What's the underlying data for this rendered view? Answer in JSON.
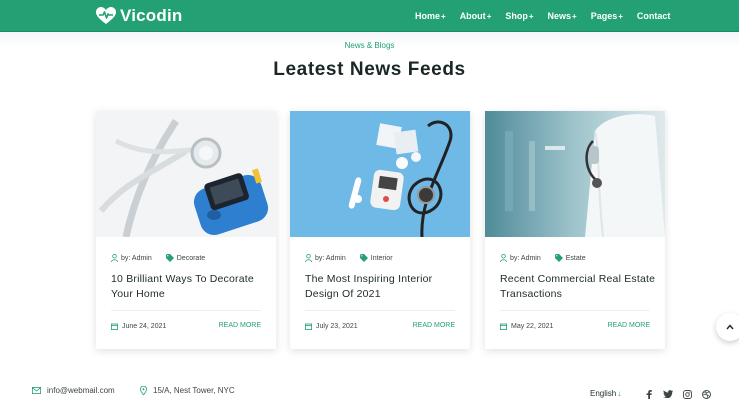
{
  "brand": {
    "name": "Vicodin",
    "logo_icon": "heart-pulse-icon"
  },
  "nav": {
    "items": [
      {
        "label": "Home",
        "suffix": "+"
      },
      {
        "label": "About",
        "suffix": "+"
      },
      {
        "label": "Shop",
        "suffix": "+"
      },
      {
        "label": "News",
        "suffix": "+"
      },
      {
        "label": "Pages",
        "suffix": "+"
      },
      {
        "label": "Contact",
        "suffix": ""
      }
    ]
  },
  "section": {
    "eyebrow": "News & Blogs",
    "title": "Leatest News Feeds"
  },
  "cards": [
    {
      "author": "by: Admin",
      "category": "Decorate",
      "title": "10 Brilliant Ways To Decorate Your Home",
      "date": "June 24, 2021",
      "cta": "READ MORE",
      "image": "glucose-meter-stethoscope"
    },
    {
      "author": "by: Admin",
      "category": "Interior",
      "title": "The Most Inspiring Interior Design Of 2021",
      "date": "July 23, 2021",
      "cta": "READ MORE",
      "image": "stethoscope-medical-supplies"
    },
    {
      "author": "by: Admin",
      "category": "Estate",
      "title": "Recent Commercial Real Estate Transactions",
      "date": "May 22, 2021",
      "cta": "READ MORE",
      "image": "doctor-hospital-corridor"
    }
  ],
  "footer": {
    "email": "info@webmail.com",
    "address": "15/A, Nest Tower, NYC",
    "language": "English",
    "social": [
      "facebook-icon",
      "twitter-icon",
      "instagram-icon",
      "dribbble-icon"
    ]
  },
  "colors": {
    "accent": "#23a074",
    "text": "#1f2a2a"
  }
}
